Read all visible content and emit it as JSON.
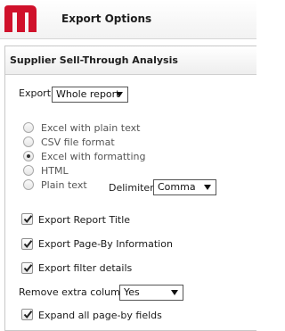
{
  "header": {
    "title": "Export Options",
    "logo_icon": "microstrategy-logo",
    "brand_color": "#d0112b"
  },
  "panel": {
    "title": "Supplier Sell-Through Analysis"
  },
  "export": {
    "label": "Export:",
    "selected": "Whole report"
  },
  "formats": [
    {
      "label": "Excel with plain text",
      "checked": false
    },
    {
      "label": "CSV file format",
      "checked": false
    },
    {
      "label": "Excel with formatting",
      "checked": true
    },
    {
      "label": "HTML",
      "checked": false
    },
    {
      "label": "Plain text",
      "checked": false
    }
  ],
  "delimiter": {
    "label": "Delimiter:",
    "selected": "Comma"
  },
  "options": [
    {
      "label": "Export Report Title",
      "checked": true
    },
    {
      "label": "Export Page-By Information",
      "checked": true
    },
    {
      "label": "Export filter details",
      "checked": true
    }
  ],
  "remove_column": {
    "label": "Remove extra column:",
    "selected": "Yes"
  },
  "expand": {
    "label": "Expand all page-by fields",
    "checked": true
  }
}
